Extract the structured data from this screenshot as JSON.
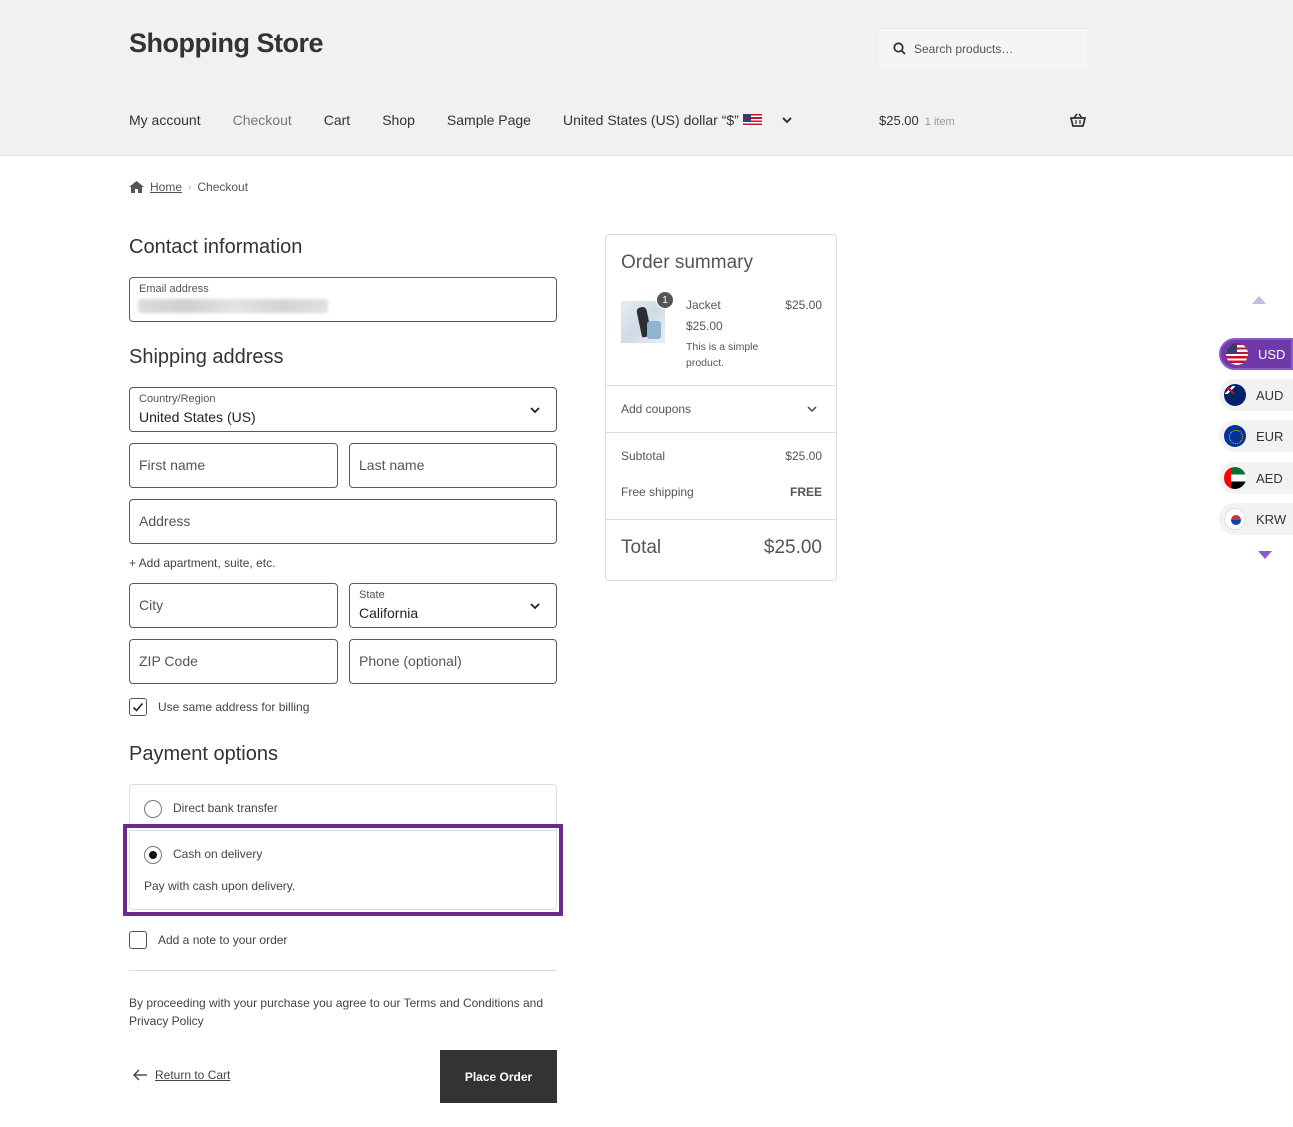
{
  "header": {
    "site_title": "Shopping Store",
    "search_placeholder": "Search products…",
    "nav": [
      "My account",
      "Checkout",
      "Cart",
      "Shop",
      "Sample Page"
    ],
    "currency_select": "United States (US) dollar “$”",
    "cart_total": "$25.00",
    "cart_count": "1 item"
  },
  "breadcrumb": {
    "home": "Home",
    "current": "Checkout"
  },
  "contact": {
    "heading": "Contact information",
    "email_label": "Email address"
  },
  "shipping": {
    "heading": "Shipping address",
    "country_label": "Country/Region",
    "country_value": "United States (US)",
    "first_name": "First name",
    "last_name": "Last name",
    "address": "Address",
    "add_apartment": "+ Add apartment, suite, etc.",
    "city": "City",
    "state_label": "State",
    "state_value": "California",
    "zip": "ZIP Code",
    "phone": "Phone (optional)",
    "same_billing": "Use same address for billing"
  },
  "payment": {
    "heading": "Payment options",
    "option1": "Direct bank transfer",
    "option2": "Cash on delivery",
    "option2_desc": "Pay with cash upon delivery.",
    "add_note": "Add a note to your order"
  },
  "footer": {
    "terms": "By proceeding with your purchase you agree to our Terms and Conditions and Privacy Policy",
    "return": "Return to Cart",
    "place_order": "Place Order"
  },
  "summary": {
    "heading": "Order summary",
    "item_qty": "1",
    "item_name": "Jacket",
    "item_price": "$25.00",
    "item_unit_price": "$25.00",
    "item_desc": "This is a simple product.",
    "coupons": "Add coupons",
    "subtotal_label": "Subtotal",
    "subtotal_value": "$25.00",
    "shipping_label": "Free shipping",
    "shipping_value": "FREE",
    "total_label": "Total",
    "total_value": "$25.00"
  },
  "currencies": [
    "USD",
    "AUD",
    "EUR",
    "AED",
    "KRW"
  ],
  "colors": {
    "accent": "#6f3aa8",
    "highlight": "#6b2a8c",
    "button": "#333333"
  }
}
